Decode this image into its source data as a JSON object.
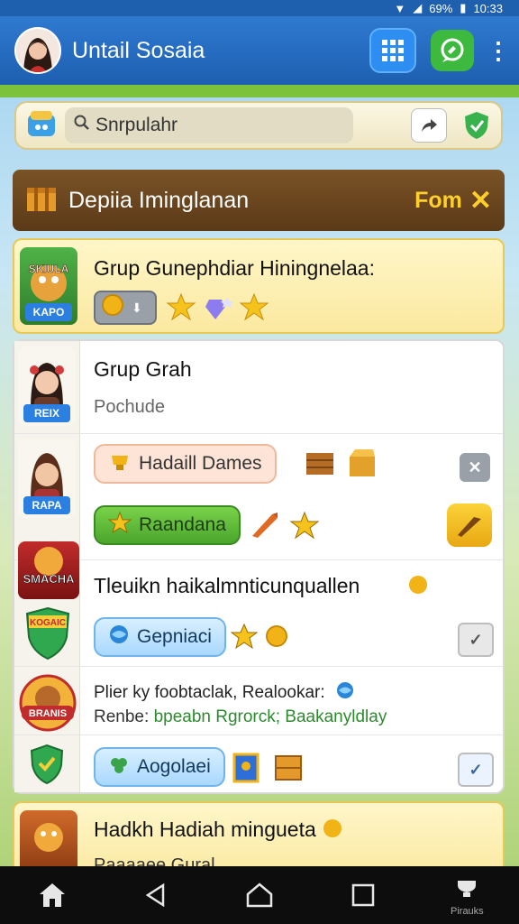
{
  "status": {
    "battery": "69%",
    "time": "10:33"
  },
  "app": {
    "title": "Untail Sosaia"
  },
  "search": {
    "text": "Snrpulahr"
  },
  "section": {
    "title": "Depiia Iminglanan",
    "action": "Fom"
  },
  "card1": {
    "thumb_text": "SKIULA",
    "tag": "KAPO",
    "title": "Grup Gunephdiar Hiningnelaa:"
  },
  "card2": {
    "row1": {
      "tag": "REIX",
      "title": "Grup Grah",
      "subtitle": "Pochude"
    },
    "row2": {
      "tag": "RAPA",
      "pill": "Hadaill Dames"
    },
    "row3": {
      "pill": "Raandana"
    },
    "row4": {
      "thumb_text": "SMACHA",
      "title": "Tleuikn haikalmnticunquallen"
    },
    "row5": {
      "thumb_text": "KOGAIC",
      "pill": "Gepniaci"
    },
    "row6": {
      "thumb_text": "BRANIS",
      "line1": "Plier ky foobtaclak, Realookar:",
      "line2_a": "Renbe:",
      "line2_b": "bpeabn Rgrorck; Baakanyldlay"
    },
    "row7": {
      "pill": "Aogolaei"
    }
  },
  "card3": {
    "title": "Hadkh Hadiah mingueta",
    "subtitle": "Paaaaee Gural"
  },
  "nav": {
    "label": "Pirauks"
  },
  "colors": {
    "appbar": "#1d5fb0",
    "accent_green": "#4aa52c",
    "header_brown": "#5b3a18",
    "gold": "#ffcf2e"
  }
}
